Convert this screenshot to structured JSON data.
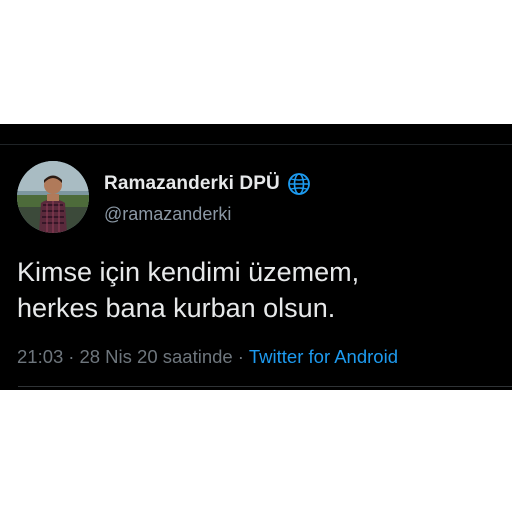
{
  "tweet": {
    "author": {
      "display_name": "Ramazanderki DPÜ",
      "username": "@ramazanderki",
      "badge_icon": "globe-icon"
    },
    "text_lines": [
      "Kimse için kendimi üzemem,",
      "herkes bana kurban olsun."
    ],
    "meta": {
      "time": "21:03",
      "separator": "·",
      "date": "28 Nis 20 saatinde",
      "source": "Twitter for Android"
    }
  },
  "colors": {
    "background": "#000000",
    "text_primary": "#e7e9ea",
    "text_secondary": "#8b98a5",
    "meta_gray": "#6e767d",
    "link_blue": "#1d9bf0"
  }
}
